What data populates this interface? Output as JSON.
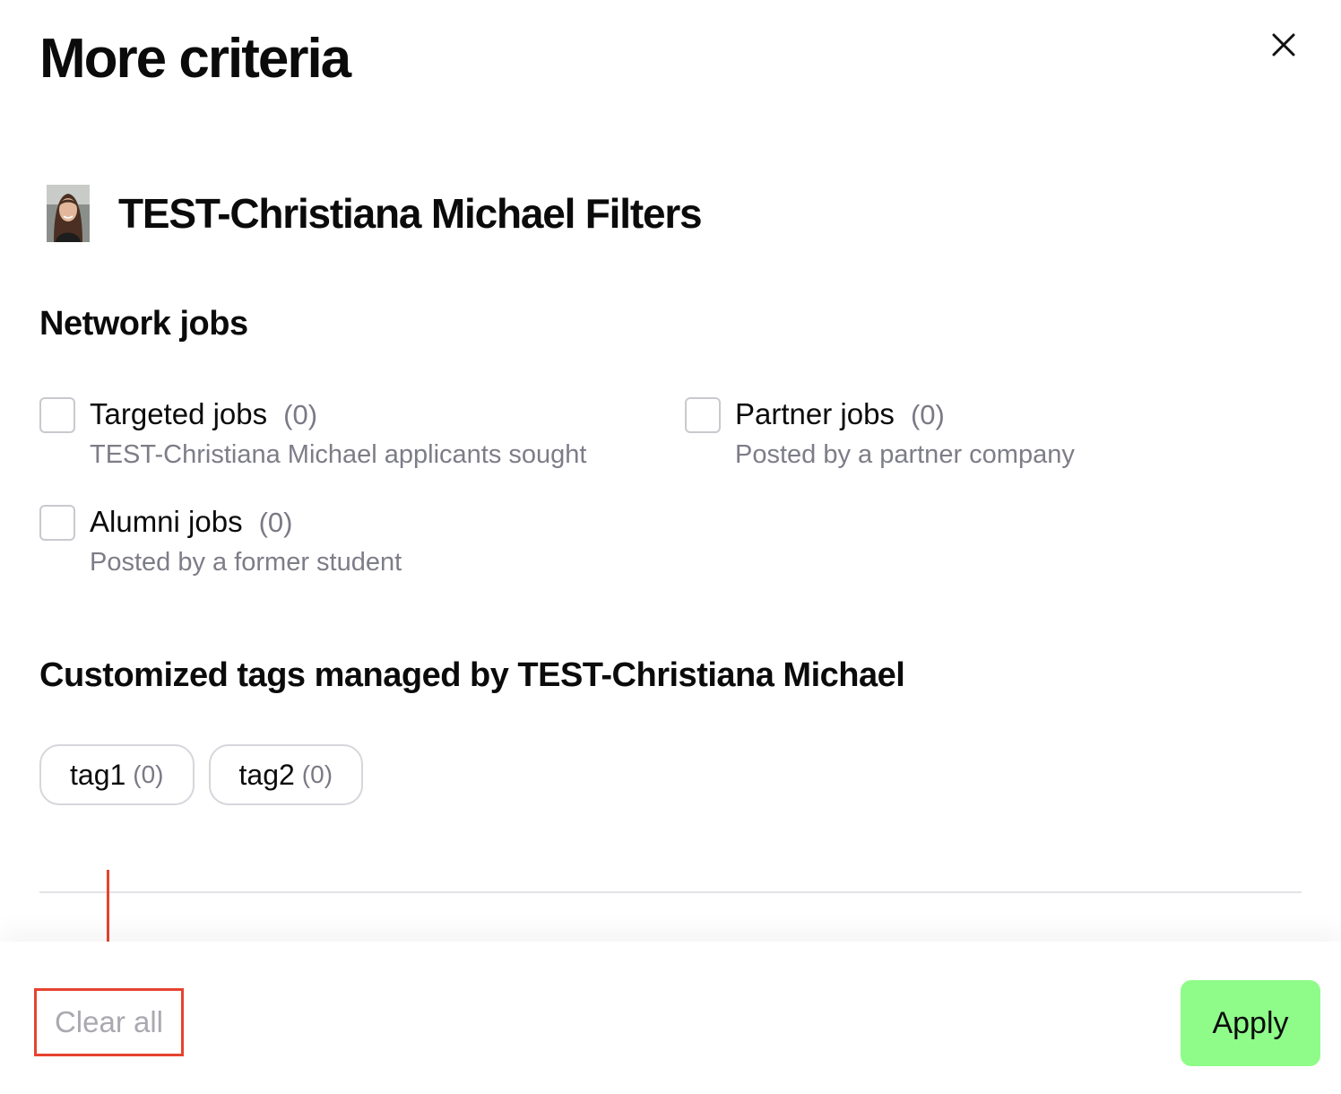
{
  "modal": {
    "title": "More criteria",
    "close_icon": "close-icon"
  },
  "organization": {
    "name": "TEST-Christiana Michael Filters",
    "avatar": "avatar"
  },
  "network_jobs": {
    "title": "Network jobs",
    "options": [
      {
        "label": "Targeted jobs",
        "count": "(0)",
        "description": "TEST-Christiana Michael applicants sought",
        "checked": false
      },
      {
        "label": "Partner jobs",
        "count": "(0)",
        "description": "Posted by a partner company",
        "checked": false
      },
      {
        "label": "Alumni jobs",
        "count": "(0)",
        "description": "Posted by a former student",
        "checked": false
      }
    ]
  },
  "custom_tags": {
    "title": "Customized tags managed by TEST-Christiana Michael",
    "tags": [
      {
        "label": "tag1",
        "count": "(0)"
      },
      {
        "label": "tag2",
        "count": "(0)"
      }
    ]
  },
  "footer": {
    "clear_label": "Clear all",
    "apply_label": "Apply"
  },
  "colors": {
    "apply_bg": "#8ffc8a",
    "annotation": "#e5432f",
    "muted_text": "#7d7d88"
  }
}
